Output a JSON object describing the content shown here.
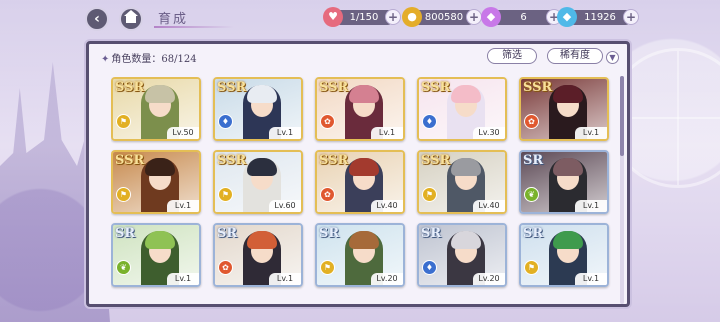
{
  "topbar": {
    "title": "育成",
    "resources": {
      "stamina": "1/150",
      "gold": "800580",
      "gem_paid": "6",
      "gem_free": "11926"
    },
    "plus": "+"
  },
  "panel": {
    "count_label": "角色数量：68/124",
    "filter_label": "筛选",
    "rarity_label": "稀有度"
  },
  "colors": {
    "ssr_border": "#e4be55",
    "sr_border": "#9cb3d8",
    "panel_border": "#574f70"
  },
  "cards": [
    {
      "rarity": "SSR",
      "level": "Lv.50",
      "attr": "yellow",
      "hair": "#c7c2a6",
      "outfit": "#7c8f4c",
      "bg": "#e8d9a8"
    },
    {
      "rarity": "SSR",
      "level": "Lv.1",
      "attr": "blue",
      "hair": "#e8ecf2",
      "outfit": "#2d3656",
      "bg": "#c9dbe8"
    },
    {
      "rarity": "SSR",
      "level": "Lv.1",
      "attr": "red",
      "hair": "#d48091",
      "outfit": "#6a2b3c",
      "bg": "#f2d9c4"
    },
    {
      "rarity": "SSR",
      "level": "Lv.30",
      "attr": "blue",
      "hair": "#f4bcc8",
      "outfit": "#e9e1f1",
      "bg": "#f6e4ee"
    },
    {
      "rarity": "SSR",
      "level": "Lv.1",
      "attr": "red",
      "hair": "#5b1e28",
      "outfit": "#2a1a1e",
      "bg": "#7a3b3a"
    },
    {
      "rarity": "SSR",
      "level": "Lv.1",
      "attr": "yellow",
      "hair": "#3a2218",
      "outfit": "#6f3a1f",
      "bg": "#c78a4e"
    },
    {
      "rarity": "SSR",
      "level": "Lv.60",
      "attr": "yellow",
      "hair": "#2b2f3e",
      "outfit": "#e3e2de",
      "bg": "#dfe7ef"
    },
    {
      "rarity": "SSR",
      "level": "Lv.40",
      "attr": "red",
      "hair": "#a33a2e",
      "outfit": "#3b3f5a",
      "bg": "#e9d3b4"
    },
    {
      "rarity": "SSR",
      "level": "Lv.40",
      "attr": "yellow",
      "hair": "#9a9ba0",
      "outfit": "#4f5866",
      "bg": "#d6d1c2"
    },
    {
      "rarity": "SR",
      "level": "Lv.1",
      "attr": "green",
      "hair": "#7d5c62",
      "outfit": "#2b2b30",
      "bg": "#5d4a56"
    },
    {
      "rarity": "SR",
      "level": "Lv.1",
      "attr": "green",
      "hair": "#8fc254",
      "outfit": "#3e5e2e",
      "bg": "#cfe3c0"
    },
    {
      "rarity": "SR",
      "level": "Lv.1",
      "attr": "red",
      "hair": "#d25f37",
      "outfit": "#2f2a36",
      "bg": "#e3d8cc"
    },
    {
      "rarity": "SR",
      "level": "Lv.20",
      "attr": "yellow",
      "hair": "#a66a3a",
      "outfit": "#4e6a3d",
      "bg": "#cfe3ee"
    },
    {
      "rarity": "SR",
      "level": "Lv.20",
      "attr": "blue",
      "hair": "#d8d6dc",
      "outfit": "#3b3742",
      "bg": "#bfc4d1"
    },
    {
      "rarity": "SR",
      "level": "Lv.1",
      "attr": "yellow",
      "hair": "#3f9b4d",
      "outfit": "#2c3a52",
      "bg": "#cfe0ee"
    }
  ]
}
